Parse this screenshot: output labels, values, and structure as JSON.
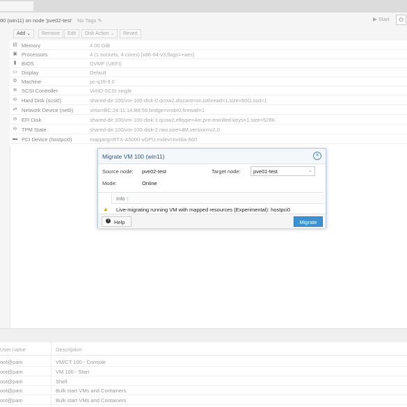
{
  "header": {
    "title": "00 (win11) on node 'pve02-test'",
    "tags": "No Tags",
    "start_label": "Start",
    "power_icon": "power-icon"
  },
  "toolbar": {
    "add": "Add",
    "remove": "Remove",
    "edit": "Edit",
    "disk_action": "Disk Action",
    "revert": "Revert"
  },
  "hardware": [
    {
      "icon": "memory-icon",
      "key": "Memory",
      "value": "4.00 GiB"
    },
    {
      "icon": "cpu-icon",
      "key": "Processors",
      "value": "4 (1 sockets, 4 cores) [x86-64-v3,flags=+aes]"
    },
    {
      "icon": "bios-icon",
      "key": "BIOS",
      "value": "OVMF (UEFI)"
    },
    {
      "icon": "display-icon",
      "key": "Display",
      "value": "Default"
    },
    {
      "icon": "gears-icon",
      "key": "Machine",
      "value": "pc-q35-9.0"
    },
    {
      "icon": "database-icon",
      "key": "SCSI Controller",
      "value": "VirtIO SCSI single"
    },
    {
      "icon": "harddisk-icon",
      "key": "Hard Disk (scsi0)",
      "value": "shared-dir:100/vm-100-disk-0.qcow2,discard=on,iothread=1,size=60G,ssd=1"
    },
    {
      "icon": "network-icon",
      "key": "Network Device (net0)",
      "value": "virtio=BC:24:11:14:B8:59,bridge=vmbr0,firewall=1"
    },
    {
      "icon": "harddisk-icon",
      "key": "EFI Disk",
      "value": "shared-dir:100/vm-100-disk-1.qcow2,efitype=4m,pre-enrolled-keys=1,size=528K"
    },
    {
      "icon": "harddisk-icon",
      "key": "TPM State",
      "value": "shared-dir:100/vm-100-disk-2.raw,size=4M,version=v2.0"
    },
    {
      "icon": "pci-icon",
      "key": "PCI Device (hostpci0)",
      "value": "mapping=RTX-A5000-vGPU,mdev=nvidia-660"
    }
  ],
  "dialog": {
    "title": "Migrate VM 100 (win11)",
    "source_label": "Source node:",
    "source_value": "pve02-test",
    "target_label": "Target node:",
    "target_value": "pve01-test",
    "mode_label": "Mode:",
    "mode_value": "Online",
    "info_header": "Info",
    "info_message": "Live-migrating running VM with mapped resources (Experimental): hostpci0",
    "help_label": "Help",
    "migrate_label": "Migrate"
  },
  "tasks": {
    "columns": [
      "User name",
      "Description"
    ],
    "rows": [
      {
        "user": "oot@pam",
        "desc": "VM/CT 100 - Console"
      },
      {
        "user": "oot@pam",
        "desc": "VM 100 - Start"
      },
      {
        "user": "oot@pam",
        "desc": "Shell"
      },
      {
        "user": "oot@pam",
        "desc": "Bulk start VMs and Containers"
      },
      {
        "user": "oot@pam",
        "desc": "Bulk start VMs and Containers"
      }
    ]
  }
}
